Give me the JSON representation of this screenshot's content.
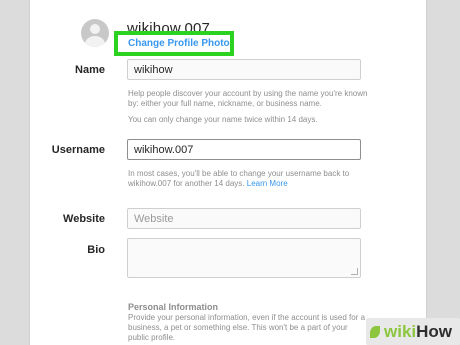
{
  "profile": {
    "username_title": "wikihow.007",
    "change_photo_label": "Change Profile Photo"
  },
  "form": {
    "name": {
      "label": "Name",
      "value": "wikihow",
      "help1": "Help people discover your account by using the name you're known by: either your full name, nickname, or business name.",
      "help2": "You can only change your name twice within 14 days."
    },
    "username": {
      "label": "Username",
      "value": "wikihow.007",
      "help": "In most cases, you'll be able to change your username back to wikihow.007 for another 14 days.",
      "help_link": "Learn More"
    },
    "website": {
      "label": "Website",
      "placeholder": "Website"
    },
    "bio": {
      "label": "Bio",
      "value": ""
    },
    "personal_info": {
      "title": "Personal Information",
      "text": "Provide your personal information, even if the account is used for a business, a pet or something else. This won't be a part of your public profile."
    }
  },
  "watermark": {
    "wiki": "wiki",
    "how": "How"
  }
}
